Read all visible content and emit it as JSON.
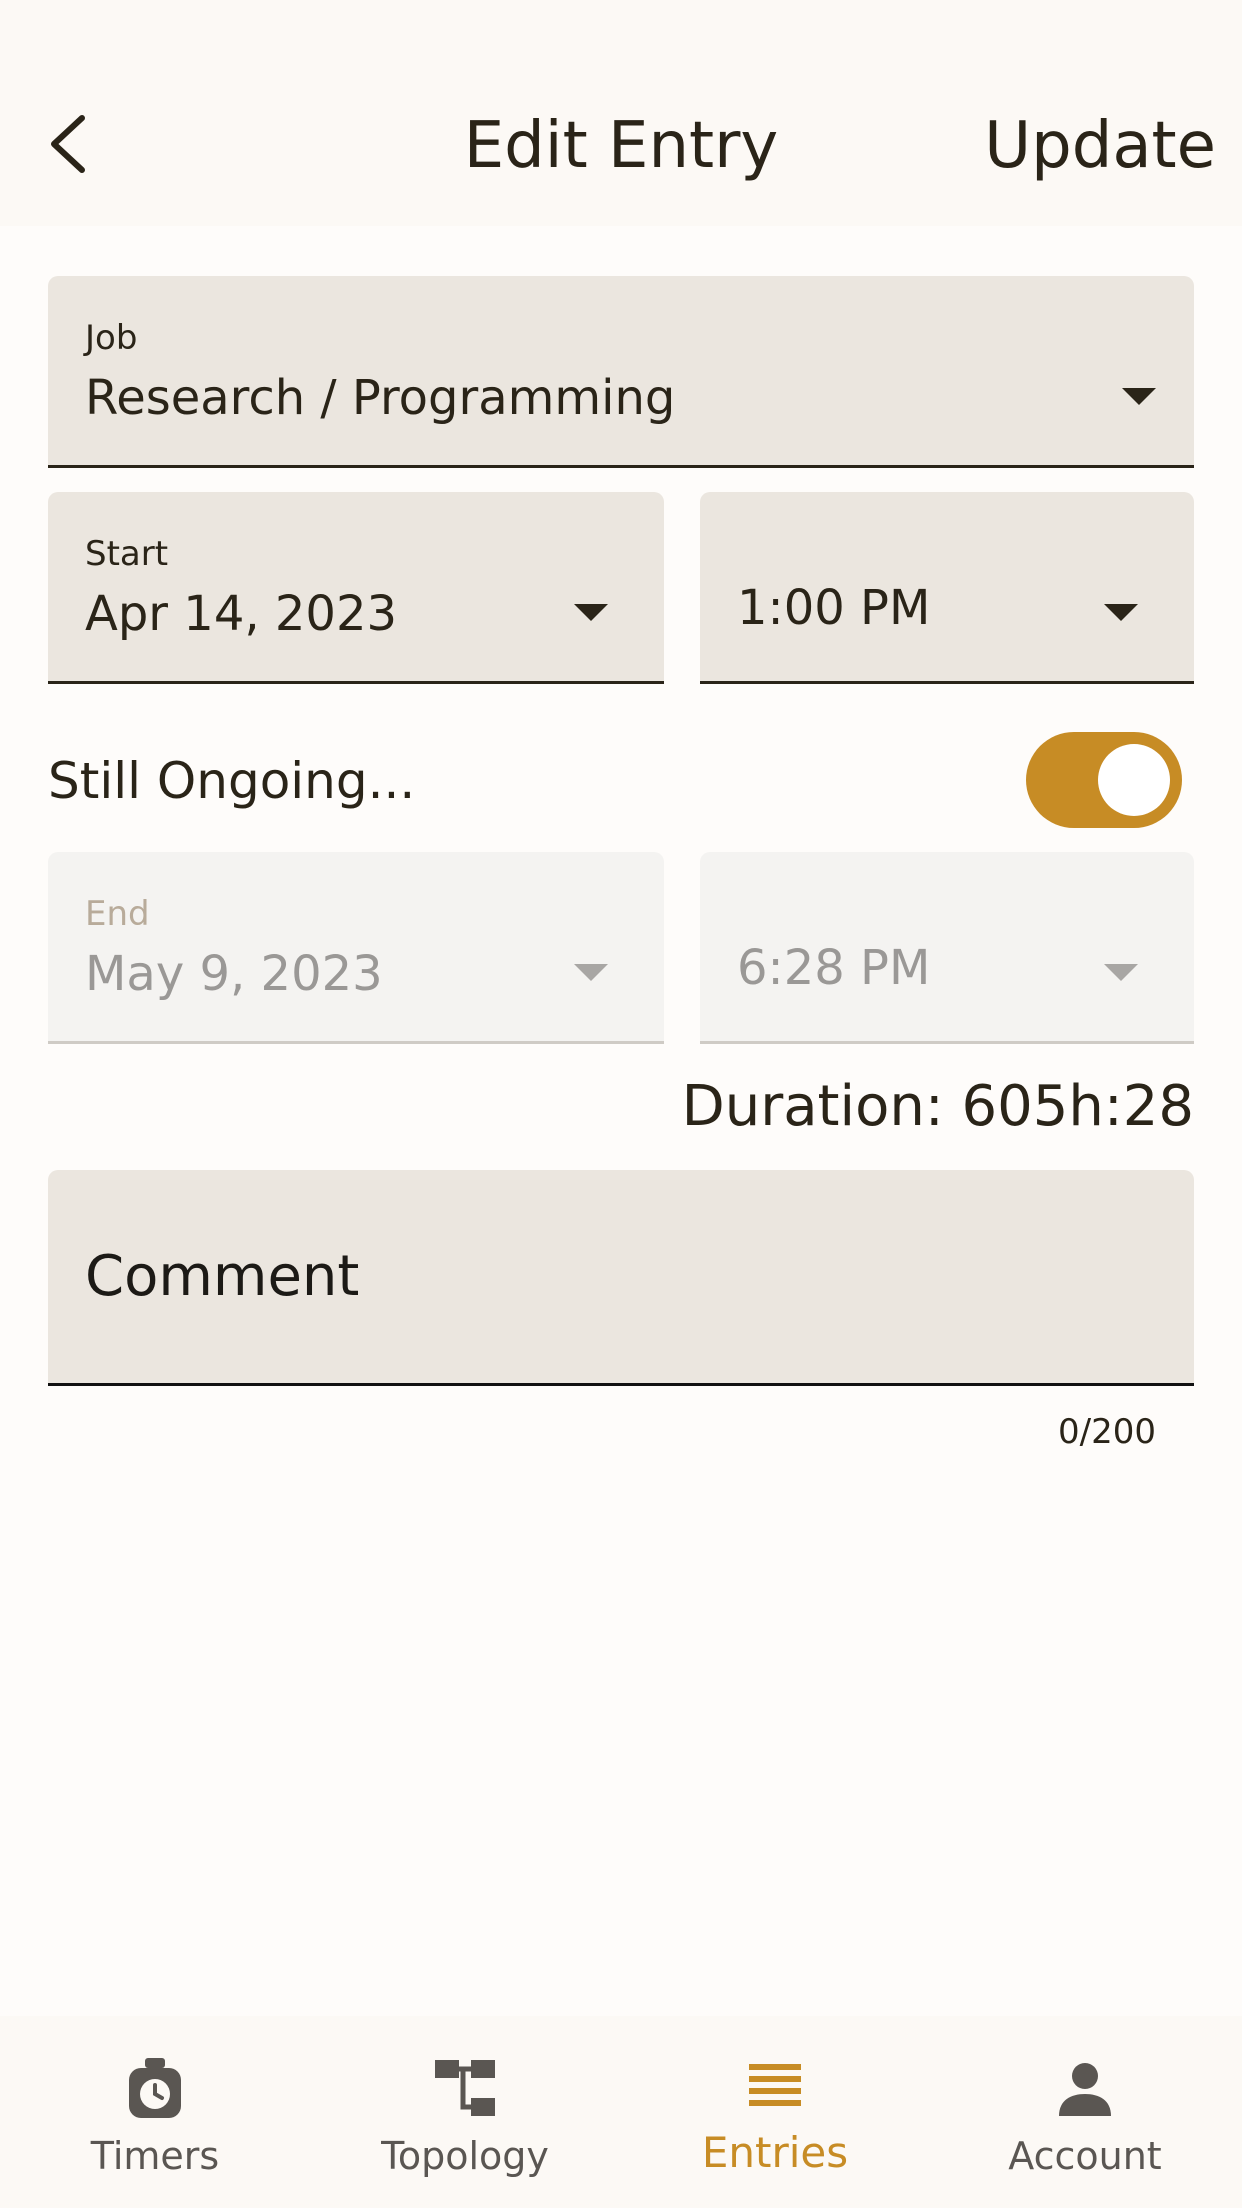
{
  "header": {
    "title": "Edit Entry",
    "action_label": "Update",
    "back_icon": "chevron-left-icon"
  },
  "form": {
    "job": {
      "label": "Job",
      "value": "Research / Programming"
    },
    "start": {
      "label": "Start",
      "date": "Apr 14, 2023",
      "time": "1:00 PM"
    },
    "ongoing": {
      "label": "Still Ongoing...",
      "checked": true
    },
    "end": {
      "label": "End",
      "date": "May 9, 2023",
      "time": "6:28 PM"
    },
    "duration": "Duration: 605h:28",
    "comment": {
      "placeholder": "Comment",
      "counter": "0/200"
    }
  },
  "nav": {
    "items": [
      {
        "label": "Timers",
        "icon": "stopwatch-icon"
      },
      {
        "label": "Topology",
        "icon": "hierarchy-icon"
      },
      {
        "label": "Entries",
        "icon": "list-icon",
        "active": true
      },
      {
        "label": "Account",
        "icon": "person-icon"
      }
    ]
  },
  "colors": {
    "accent": "#c78c25",
    "text": "#2a2418",
    "field_bg": "#ebe6df",
    "background": "#fefcfa"
  }
}
